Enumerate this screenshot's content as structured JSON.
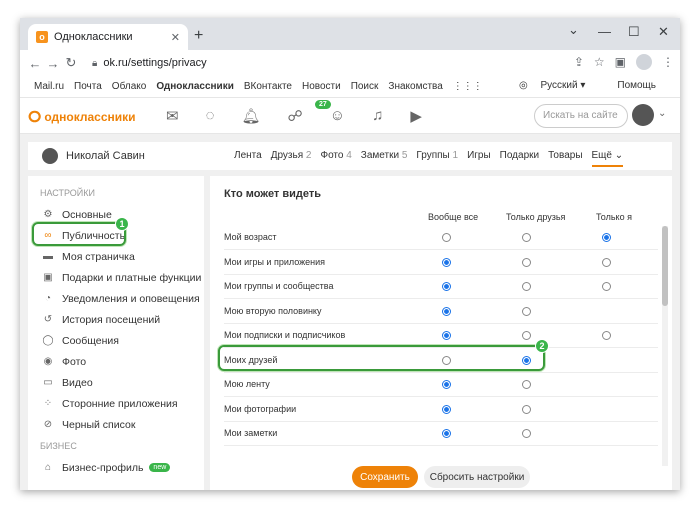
{
  "browser": {
    "tab_title": "Одноклассники",
    "tab_close": "✕",
    "new_tab": "+",
    "url": "ok.ru/settings/privacy",
    "win_minimize": "—",
    "win_maximize": "☐",
    "win_close": "✕",
    "collapse": "⌄"
  },
  "portal": {
    "links": [
      "Mail.ru",
      "Почта",
      "Облако",
      "Одноклассники",
      "ВКонтакте",
      "Новости",
      "Поиск",
      "Знакомства"
    ],
    "language": "Русский ▾",
    "help": "Помощь"
  },
  "ok_header": {
    "logo": "одноклассники",
    "badge": "27",
    "search_placeholder": "Искать на сайте"
  },
  "profile": {
    "name": "Николай Савин",
    "nav": [
      {
        "label": "Лента",
        "count": ""
      },
      {
        "label": "Друзья",
        "count": "2"
      },
      {
        "label": "Фото",
        "count": "4"
      },
      {
        "label": "Заметки",
        "count": "5"
      },
      {
        "label": "Группы",
        "count": "1"
      },
      {
        "label": "Игры",
        "count": ""
      },
      {
        "label": "Подарки",
        "count": ""
      },
      {
        "label": "Товары",
        "count": ""
      }
    ],
    "more": "Ещё"
  },
  "sidebar": {
    "settings_heading": "Настройки",
    "items": [
      {
        "label": "Основные",
        "icon": "gear-icon"
      },
      {
        "label": "Публичность",
        "icon": "glasses-icon"
      },
      {
        "label": "Моя страничка",
        "icon": "page-icon"
      },
      {
        "label": "Подарки и платные функции",
        "icon": "gift-icon"
      },
      {
        "label": "Уведомления и оповещения",
        "icon": "bell-icon"
      },
      {
        "label": "История посещений",
        "icon": "history-icon"
      },
      {
        "label": "Сообщения",
        "icon": "chat-icon"
      },
      {
        "label": "Фото",
        "icon": "camera-icon"
      },
      {
        "label": "Видео",
        "icon": "video-icon"
      },
      {
        "label": "Сторонние приложения",
        "icon": "apps-icon"
      },
      {
        "label": "Черный список",
        "icon": "block-icon"
      }
    ],
    "business_heading": "Бизнес",
    "business_item": "Бизнес-профиль",
    "new_badge": "new"
  },
  "privacy": {
    "title": "Кто может видеть",
    "columns": [
      "Вообще все",
      "Только друзья",
      "Только я"
    ],
    "rows": [
      {
        "label": "Мой возраст",
        "options": 3,
        "selected": 2
      },
      {
        "label": "Мои игры и приложения",
        "options": 3,
        "selected": 0
      },
      {
        "label": "Мои группы и сообщества",
        "options": 3,
        "selected": 0
      },
      {
        "label": "Мою вторую половинку",
        "options": 2,
        "selected": 0
      },
      {
        "label": "Мои подписки и подписчиков",
        "options": 3,
        "selected": 0
      },
      {
        "label": "Моих друзей",
        "options": 2,
        "selected": 1
      },
      {
        "label": "Мою ленту",
        "options": 2,
        "selected": 0
      },
      {
        "label": "Мои фотографии",
        "options": 2,
        "selected": 0
      },
      {
        "label": "Мои заметки",
        "options": 2,
        "selected": 0
      }
    ],
    "save_label": "Сохранить",
    "reset_label": "Сбросить настройки"
  },
  "annotations": [
    "1",
    "2"
  ],
  "colors": {
    "accent": "#ee8208",
    "highlight": "#3ab54a",
    "radio": "#1a73e8"
  }
}
